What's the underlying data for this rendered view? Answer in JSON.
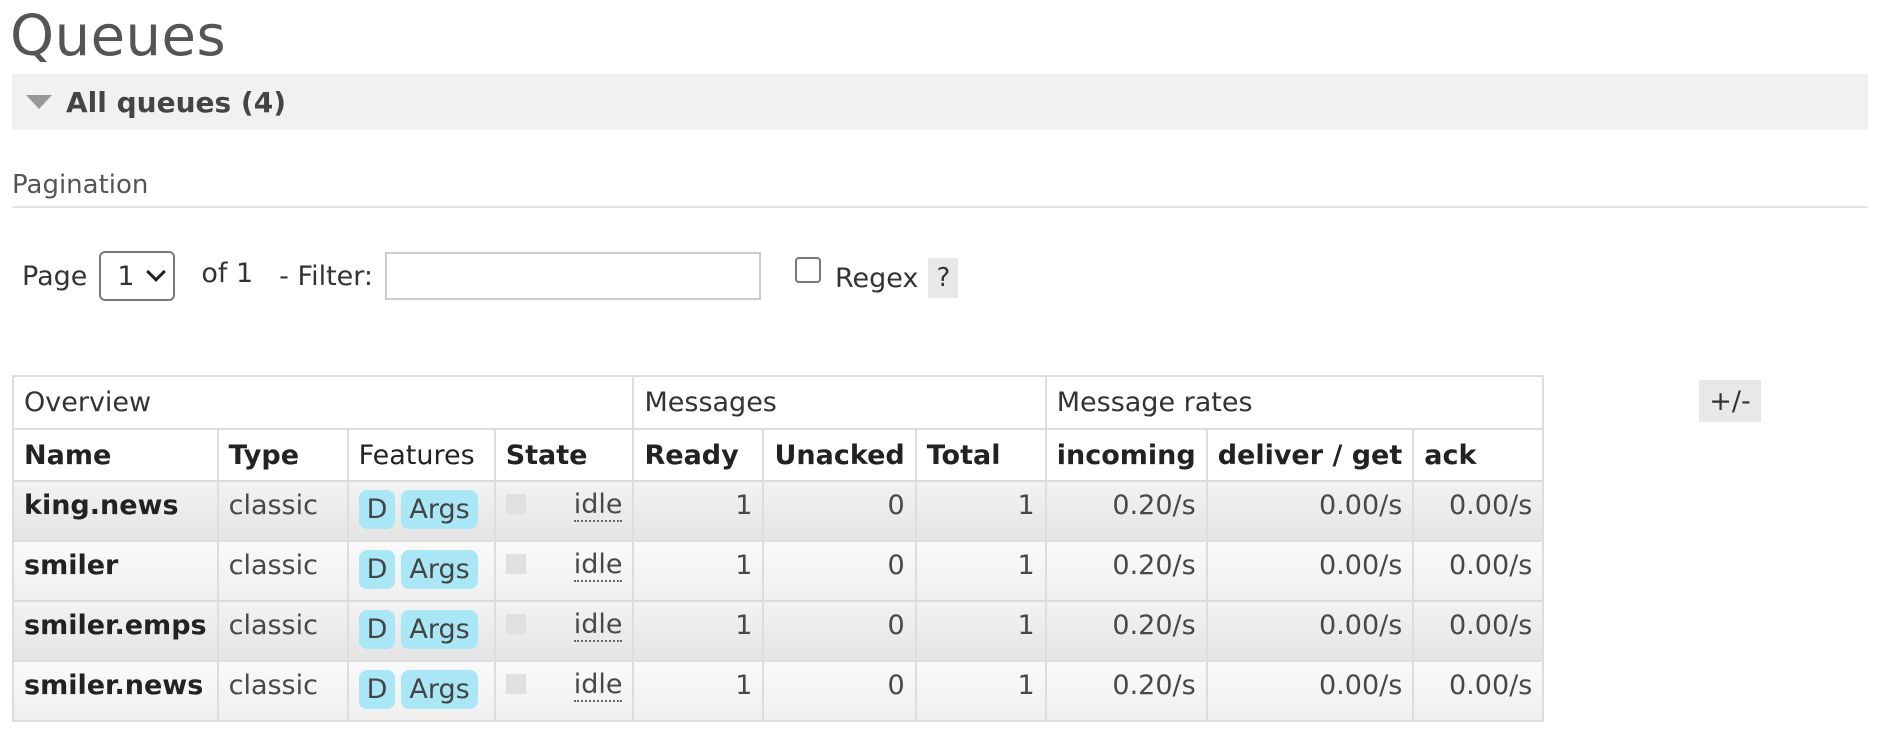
{
  "page": {
    "title": "Queues"
  },
  "section": {
    "title": "All queues (4)"
  },
  "pagination": {
    "heading": "Pagination",
    "page_label": "Page",
    "page_value": "1",
    "of_label": "of 1",
    "filter_label": "- Filter:",
    "filter_value": "",
    "regex_checked": false,
    "regex_label": "Regex",
    "help_label": "?"
  },
  "table": {
    "groups": [
      "Overview",
      "Messages",
      "Message rates"
    ],
    "columns": [
      "Name",
      "Type",
      "Features",
      "State",
      "Ready",
      "Unacked",
      "Total",
      "incoming",
      "deliver / get",
      "ack"
    ],
    "toggle_label": "+/-",
    "rows": [
      {
        "name": "king.news",
        "type": "classic",
        "features": [
          "D",
          "Args"
        ],
        "state": "idle",
        "ready": "1",
        "unacked": "0",
        "total": "1",
        "incoming": "0.20/s",
        "deliver_get": "0.00/s",
        "ack": "0.00/s"
      },
      {
        "name": "smiler",
        "type": "classic",
        "features": [
          "D",
          "Args"
        ],
        "state": "idle",
        "ready": "1",
        "unacked": "0",
        "total": "1",
        "incoming": "0.20/s",
        "deliver_get": "0.00/s",
        "ack": "0.00/s"
      },
      {
        "name": "smiler.emps",
        "type": "classic",
        "features": [
          "D",
          "Args"
        ],
        "state": "idle",
        "ready": "1",
        "unacked": "0",
        "total": "1",
        "incoming": "0.20/s",
        "deliver_get": "0.00/s",
        "ack": "0.00/s"
      },
      {
        "name": "smiler.news",
        "type": "classic",
        "features": [
          "D",
          "Args"
        ],
        "state": "idle",
        "ready": "1",
        "unacked": "0",
        "total": "1",
        "incoming": "0.20/s",
        "deliver_get": "0.00/s",
        "ack": "0.00/s"
      }
    ]
  }
}
